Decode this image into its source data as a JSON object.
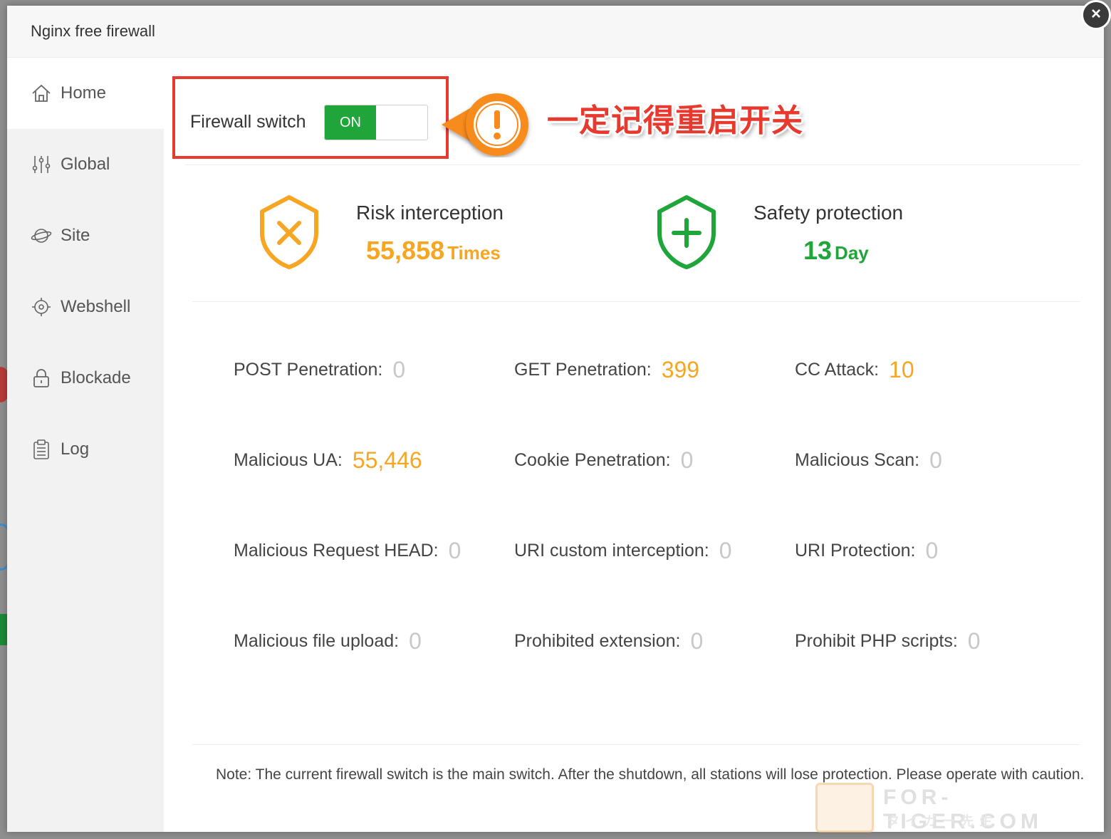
{
  "window": {
    "title": "Nginx free firewall",
    "close_symbol": "×"
  },
  "sidebar": {
    "items": [
      {
        "label": "Home",
        "icon": "home-icon",
        "active": true
      },
      {
        "label": "Global",
        "icon": "sliders-icon"
      },
      {
        "label": "Site",
        "icon": "planet-icon"
      },
      {
        "label": "Webshell",
        "icon": "target-icon"
      },
      {
        "label": "Blockade",
        "icon": "lock-icon"
      },
      {
        "label": "Log",
        "icon": "clipboard-icon"
      }
    ]
  },
  "firewall": {
    "switch_label": "Firewall switch",
    "switch_state": "ON",
    "annotation": "一定记得重启开关",
    "highlight_color": "#e8392f"
  },
  "stats": {
    "risk": {
      "title": "Risk interception",
      "value": "55,858",
      "unit": "Times",
      "icon": "shield-x-icon",
      "color": "#f6a623"
    },
    "safety": {
      "title": "Safety protection",
      "value": "13",
      "unit": "Day",
      "icon": "shield-plus-icon",
      "color": "#20a53a"
    }
  },
  "attacks": [
    {
      "label": "POST Penetration:",
      "value": "0"
    },
    {
      "label": "GET Penetration:",
      "value": "399"
    },
    {
      "label": "CC Attack:",
      "value": "10"
    },
    {
      "label": "Malicious UA:",
      "value": "55,446"
    },
    {
      "label": "Cookie Penetration:",
      "value": "0"
    },
    {
      "label": "Malicious Scan:",
      "value": "0"
    },
    {
      "label": "Malicious Request HEAD:",
      "value": "0"
    },
    {
      "label": "URI custom interception:",
      "value": "0"
    },
    {
      "label": "URI Protection:",
      "value": "0"
    },
    {
      "label": "Malicious file upload:",
      "value": "0"
    },
    {
      "label": "Prohibited extension:",
      "value": "0"
    },
    {
      "label": "Prohibit PHP scripts:",
      "value": "0"
    }
  ],
  "note": "Note: The current firewall switch is the main switch. After the shutdown, all stations will lose protection. Please operate with caution.",
  "watermark": {
    "text": "FOR-TIGER.COM",
    "sub": "タイガー先生"
  }
}
